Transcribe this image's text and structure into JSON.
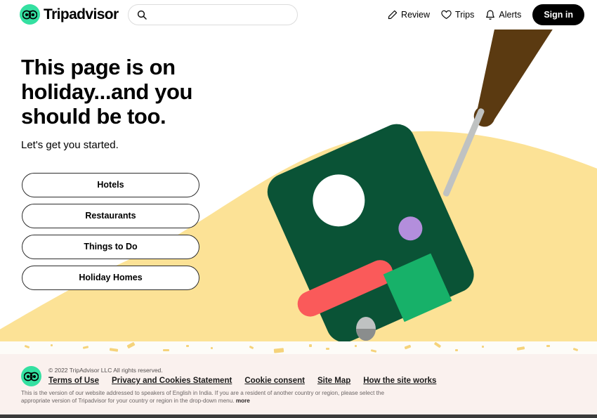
{
  "header": {
    "brand_name": "Tripadvisor",
    "brand_icon": "owl-logo-icon",
    "accent_color": "#34E0A1",
    "search": {
      "placeholder": "",
      "value": "",
      "icon": "search-icon"
    },
    "nav_items": [
      {
        "label": "Review",
        "icon": "pencil-icon"
      },
      {
        "label": "Trips",
        "icon": "heart-icon"
      },
      {
        "label": "Alerts",
        "icon": "bell-icon"
      }
    ],
    "sign_in_label": "Sign in"
  },
  "hero": {
    "heading": "This page is on holiday...and you should be too.",
    "subheading": "Let's get you started.",
    "cta_buttons": [
      {
        "label": "Hotels"
      },
      {
        "label": "Restaurants"
      },
      {
        "label": "Things to Do"
      },
      {
        "label": "Holiday Homes"
      }
    ]
  },
  "illustration": {
    "name": "suitcase-on-luggage-cart-illustration",
    "colors": {
      "suitcase_green": "#0A5336",
      "blob_yellow": "#FCE296",
      "stripe_red": "#FA5A5A",
      "tag_green": "#17B169",
      "dot_purple": "#B38EDC",
      "handle_grey": "#C4C4C4",
      "arm_brown": "#5B3A11",
      "white": "#FFFFFF"
    }
  },
  "footer": {
    "logo_icon": "owl-logo-icon",
    "copyright": "© 2022 TripAdvisor LLC All rights reserved.",
    "links": [
      {
        "label": "Terms of Use"
      },
      {
        "label": "Privacy and Cookies Statement"
      },
      {
        "label": "Cookie consent"
      },
      {
        "label": "Site Map"
      },
      {
        "label": "How the site works"
      }
    ],
    "region_note": "This is the version of our website addressed to speakers of English in India. If you are a resident of another country or region, please select the appropriate version of Tripadvisor for your country or region in the drop-down menu.",
    "region_note_more": "more"
  }
}
